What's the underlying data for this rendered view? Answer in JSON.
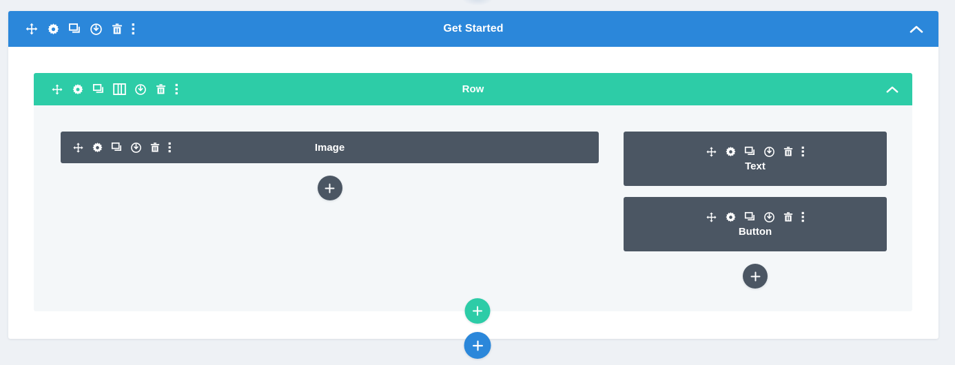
{
  "section": {
    "title": "Get Started",
    "color": "#2b87da",
    "tools": [
      {
        "name": "move-icon",
        "label": "Move section"
      },
      {
        "name": "gear-icon",
        "label": "Section settings"
      },
      {
        "name": "duplicate-icon",
        "label": "Duplicate section"
      },
      {
        "name": "power-icon",
        "label": "Disable section"
      },
      {
        "name": "trash-icon",
        "label": "Delete section"
      },
      {
        "name": "more-options-icon",
        "label": "More options"
      }
    ],
    "collapse_icon": "chevron-up-icon"
  },
  "row": {
    "title": "Row",
    "color": "#2dcca7",
    "tools": [
      {
        "name": "move-icon",
        "label": "Move row"
      },
      {
        "name": "gear-icon",
        "label": "Row settings"
      },
      {
        "name": "duplicate-icon",
        "label": "Duplicate row"
      },
      {
        "name": "columns-icon",
        "label": "Change column structure"
      },
      {
        "name": "power-icon",
        "label": "Disable row"
      },
      {
        "name": "trash-icon",
        "label": "Delete row"
      },
      {
        "name": "more-options-icon",
        "label": "More options"
      }
    ],
    "collapse_icon": "chevron-up-icon"
  },
  "modules": {
    "color": "#4b5663",
    "tools": [
      {
        "name": "move-icon",
        "label": "Move module"
      },
      {
        "name": "gear-icon",
        "label": "Module settings"
      },
      {
        "name": "duplicate-icon",
        "label": "Duplicate module"
      },
      {
        "name": "power-icon",
        "label": "Disable module"
      },
      {
        "name": "trash-icon",
        "label": "Delete module"
      },
      {
        "name": "more-options-icon",
        "label": "More options"
      }
    ],
    "image": {
      "title": "Image"
    },
    "text": {
      "title": "Text"
    },
    "button": {
      "title": "Button"
    }
  },
  "add_buttons": {
    "glyph": "+",
    "add_module_left": {
      "label": "Add new module",
      "color": "#4b5663"
    },
    "add_module_right": {
      "label": "Add new module",
      "color": "#4b5663"
    },
    "add_row": {
      "label": "Add new row",
      "color": "#2dcca7"
    },
    "add_section": {
      "label": "Add new section",
      "color": "#2b87da"
    }
  }
}
